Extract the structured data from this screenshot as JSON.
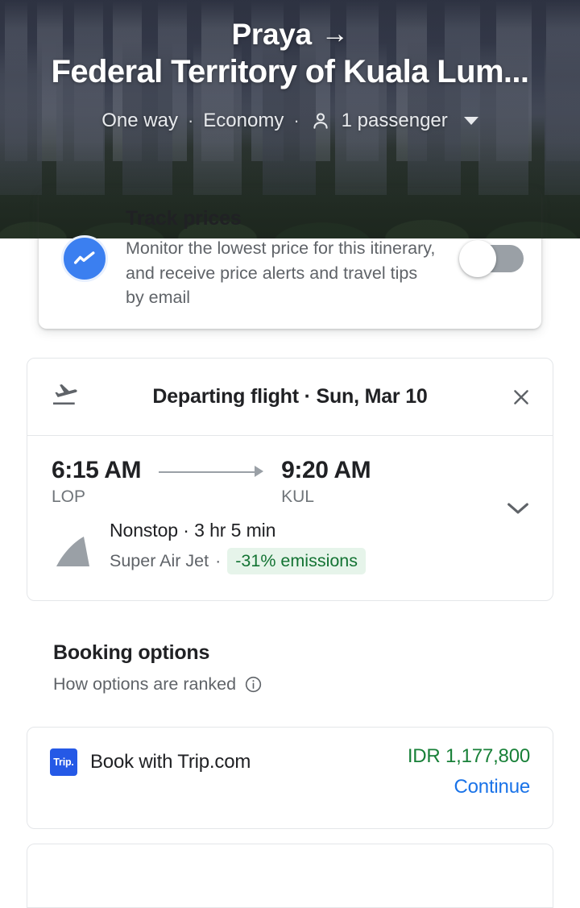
{
  "hero": {
    "origin": "Praya",
    "arrow_glyph": "→",
    "destination": "Federal Territory of Kuala Lum...",
    "trip_type": "One way",
    "cabin_class": "Economy",
    "separator": "·",
    "passengers": "1 passenger",
    "passenger_icon": "person-icon",
    "dropdown_icon": "caret-down-icon"
  },
  "track_prices": {
    "icon": "price-trend-icon",
    "title": "Track prices",
    "description": "Monitor the lowest price for this itinerary, and receive price alerts and travel tips by email",
    "toggle_state": "off",
    "toggle_name": "track-prices-toggle"
  },
  "flight": {
    "header_icon": "flight-takeoff-icon",
    "header_title": "Departing flight · Sun, Mar 10",
    "close_icon": "close-icon",
    "depart_time": "6:15 AM",
    "depart_code": "LOP",
    "arrive_time": "9:20 AM",
    "arrive_code": "KUL",
    "expand_icon": "chevron-down-icon",
    "stops_duration": "Nonstop · 3 hr 5 min",
    "airline": "Super Air Jet",
    "airline_sep": "·",
    "emissions_badge": "-31% emissions",
    "tail_icon": "airline-tail-icon"
  },
  "booking": {
    "title": "Booking options",
    "ranked_text": "How options are ranked",
    "info_icon": "info-icon",
    "offers": [
      {
        "logo_text": "Trip.",
        "name": "Book with Trip.com",
        "price": "IDR 1,177,800",
        "action": "Continue"
      }
    ]
  },
  "colors": {
    "accent_blue": "#1a73e8",
    "price_green": "#188038",
    "emissions_bg": "#e6f4ea",
    "emissions_text": "#137333",
    "trip_logo_blue": "#2559e6",
    "toggle_track": "#9aa0a6",
    "track_icon_blue": "#3b7ff0"
  }
}
